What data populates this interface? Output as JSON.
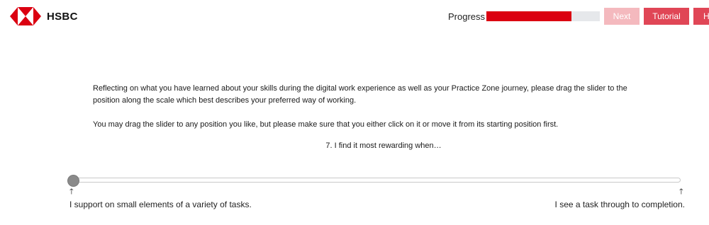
{
  "header": {
    "brand": "HSBC",
    "progress_label": "Progress",
    "progress_fraction": 0.75,
    "buttons": {
      "next": "Next",
      "tutorial": "Tutorial",
      "help": "H"
    }
  },
  "content": {
    "instruction_1": "Reflecting on what you have learned about your skills during the digital work experience as well as your Practice Zone journey, please drag the slider to the position along the scale which best describes your preferred way of working.",
    "instruction_2": "You may drag the slider to any position you like, but please make sure that you either click on it or move it from its starting position first.",
    "question": "7. I find it most rewarding when…"
  },
  "slider": {
    "value_fraction": 0.0,
    "left_label": "I support on small elements of a variety of tasks.",
    "right_label": "I see a task through to completion."
  },
  "colors": {
    "brand_red": "#db0011",
    "button_active": "#e04656",
    "button_disabled": "#f4b9be"
  }
}
